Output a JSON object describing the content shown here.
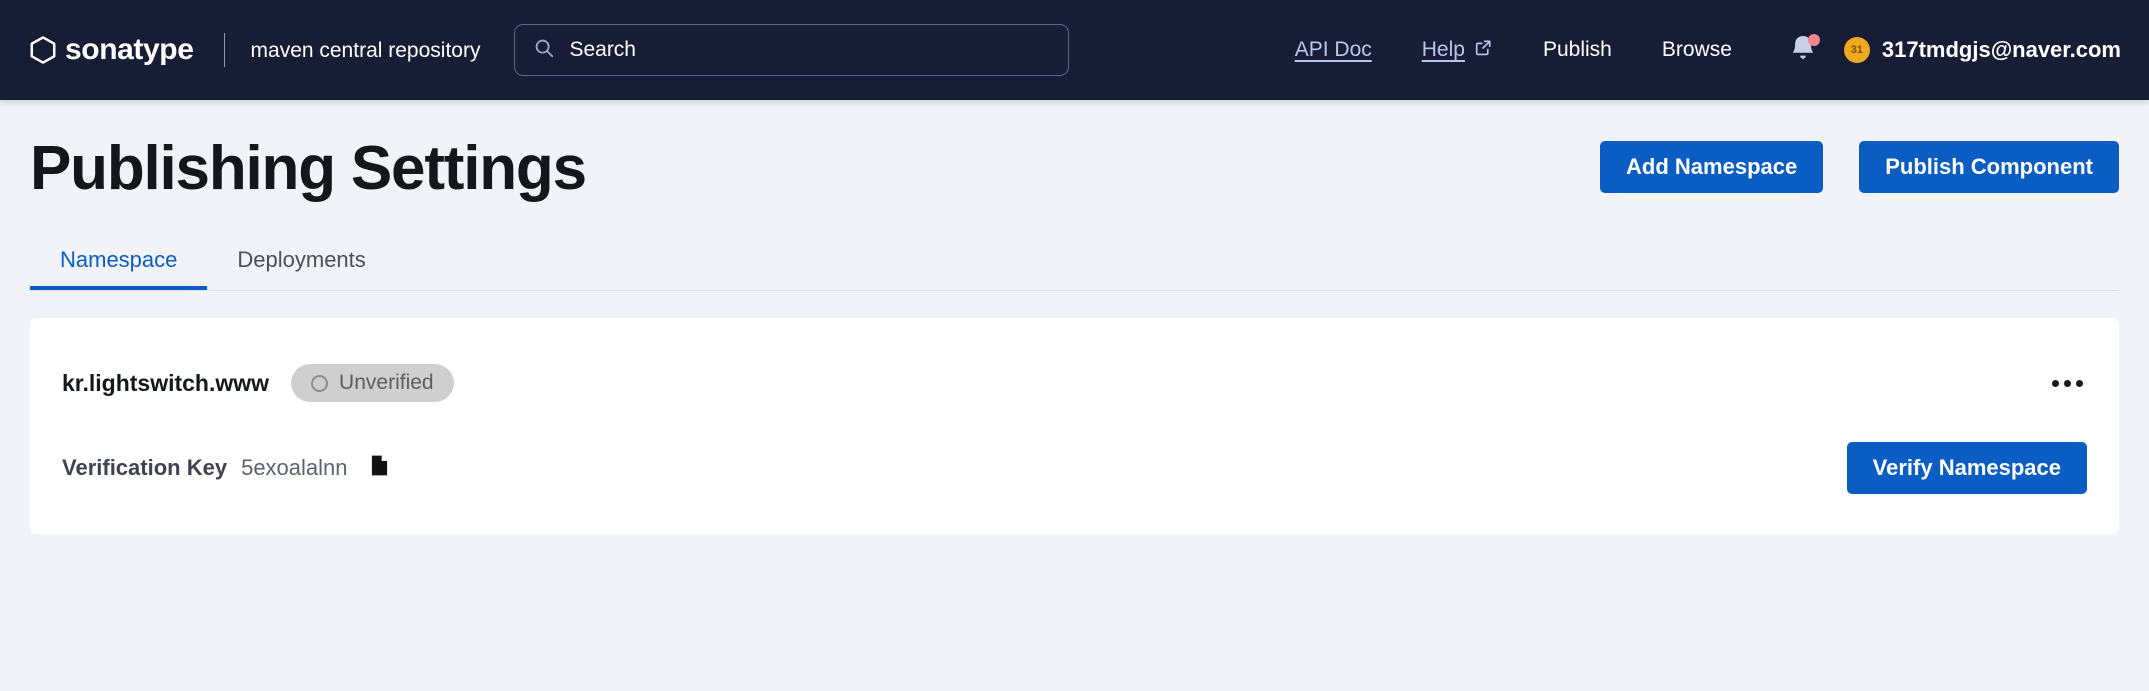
{
  "header": {
    "logo_icon": "hexagon-logo-icon",
    "brand": "sonatype",
    "brand_subtitle": "maven central repository",
    "search": {
      "icon": "search-icon",
      "placeholder": "Search",
      "value": ""
    },
    "links": [
      {
        "label": "API Doc",
        "style": "link",
        "icon": null
      },
      {
        "label": "Help",
        "style": "link",
        "icon": "external-link-icon"
      },
      {
        "label": "Publish",
        "style": "plain",
        "icon": null
      },
      {
        "label": "Browse",
        "style": "plain",
        "icon": null
      }
    ],
    "notifications": {
      "icon": "bell-icon",
      "has_unread_dot": true
    },
    "account": {
      "avatar_icon": "user-avatar",
      "avatar_text": "31",
      "email": "317tmdgjs@naver.com"
    }
  },
  "main": {
    "page_title": "Publishing Settings",
    "actions": [
      {
        "label": "Add Namespace"
      },
      {
        "label": "Publish Component"
      }
    ],
    "tabs": [
      {
        "label": "Namespace",
        "active": true
      },
      {
        "label": "Deployments",
        "active": false
      }
    ],
    "namespace_card": {
      "name": "kr.lightswitch.www",
      "status_badge": {
        "label": "Unverified",
        "icon": "circle-outline-icon"
      },
      "menu_icon": "more-options-icon",
      "verification_key_label": "Verification Key",
      "verification_key_value": "5exoalalnn",
      "copy_icon": "copy-document-icon",
      "verify_button": "Verify Namespace"
    }
  },
  "colors": {
    "header_bg": "#181d36",
    "page_bg": "#f2f3f8",
    "primary": "#0a5dc2",
    "link": "#b9c7ef",
    "badge_bg": "#cfcfcf",
    "avatar": "#f0a81e",
    "notification_dot": "#f4868c"
  }
}
